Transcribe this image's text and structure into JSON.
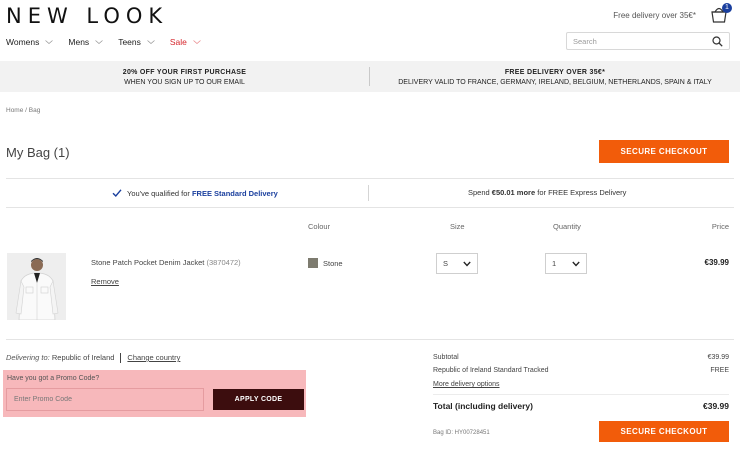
{
  "header": {
    "logo": "NEW LOOK",
    "free_delivery": "Free delivery over 35€*",
    "bag_count": "1",
    "nav": [
      {
        "label": "Womens"
      },
      {
        "label": "Mens"
      },
      {
        "label": "Teens"
      },
      {
        "label": "Sale"
      }
    ],
    "search_placeholder": "Search"
  },
  "promo_band": {
    "left_title": "20% OFF YOUR FIRST PURCHASE",
    "left_sub": "WHEN YOU SIGN UP TO OUR EMAIL",
    "right_title": "FREE DELIVERY OVER 35€*",
    "right_sub": "DELIVERY VALID TO FRANCE, GERMANY, IRELAND, BELGIUM, NETHERLANDS, SPAIN & ITALY"
  },
  "breadcrumb": "Home / Bag",
  "page_title": "My Bag (1)",
  "checkout_label": "SECURE CHECKOUT",
  "delivery_status": {
    "qualified_prefix": "You've qualified for ",
    "qualified_highlight": "FREE Standard Delivery",
    "express_prefix": "Spend ",
    "express_amount": "€50.01 more",
    "express_suffix": " for FREE Express Delivery"
  },
  "columns": {
    "colour": "Colour",
    "size": "Size",
    "quantity": "Quantity",
    "price": "Price"
  },
  "item": {
    "name": "Stone Patch Pocket Denim Jacket",
    "code": "(3870472)",
    "remove": "Remove",
    "colour": "Stone",
    "colour_hex": "#7d7b6f",
    "size": "S",
    "quantity": "1",
    "price": "€39.99"
  },
  "delivery": {
    "label": "Delivering to:",
    "country": "Republic of Ireland",
    "change": "Change country"
  },
  "promo_code": {
    "label": "Have you got a Promo Code?",
    "placeholder": "Enter Promo Code",
    "button": "APPLY CODE"
  },
  "summary": {
    "subtotal_label": "Subtotal",
    "subtotal_value": "€39.99",
    "shipping_label": "Republic of Ireland Standard Tracked",
    "shipping_value": "FREE",
    "more_options": "More delivery options",
    "total_label": "Total (including delivery)",
    "total_value": "€39.99",
    "bag_id": "Bag ID: HY00728451"
  },
  "colors": {
    "accent_orange": "#f25c0a",
    "sale_red": "#d6262c",
    "apply_button": "#3c0d0e",
    "promo_highlight": "#f7b8bb",
    "link_blue": "#1a3f9e"
  }
}
